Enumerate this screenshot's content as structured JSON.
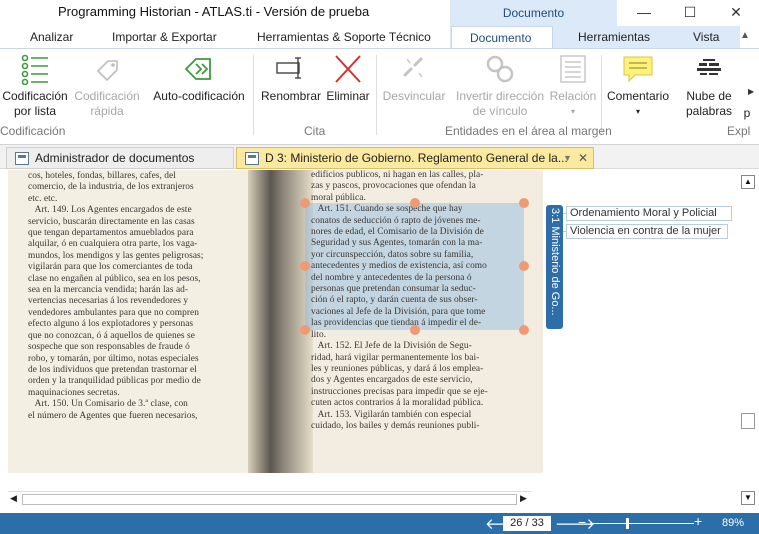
{
  "app": {
    "title": "Programming Historian - ATLAS.ti - Versión de prueba",
    "context_tab": "Documento",
    "window_buttons": [
      "—",
      "☐",
      "✕"
    ]
  },
  "ribbon_tabs": [
    {
      "label": "Analizar"
    },
    {
      "label": "Importar & Exportar"
    },
    {
      "label": "Herramientas & Soporte Técnico"
    },
    {
      "label": "Documento",
      "active": true
    },
    {
      "label": "Herramientas"
    },
    {
      "label": "Vista"
    }
  ],
  "ribbon": {
    "buttons": {
      "codificacion_lista": "Codificación\npor lista",
      "codificacion_rapida": "Codificación\nrápida",
      "auto_codificacion": "Auto-codificación",
      "renombrar": "Renombrar",
      "eliminar": "Eliminar",
      "desvincular": "Desvincular",
      "invertir": "Invertir dirección\nde vínculo",
      "relacion": "Relación",
      "comentario": "Comentario",
      "nube": "Nube de\npalabras",
      "truncated": "p"
    },
    "groups": {
      "codificacion": "Codificación",
      "cita": "Cita",
      "entidades": "Entidades en el área al margen",
      "explorar": "Expl"
    }
  },
  "doc_tabs": [
    {
      "label": "Administrador de documentos",
      "active": false
    },
    {
      "label": "D 3: Ministerio de Gobierno. Reglamento General de la...",
      "active": true
    }
  ],
  "document": {
    "left_page_lines": [
      "cos, hoteles, fondas, billares, cafes, del",
      "comercio, de la industria, de los extranjeros",
      "etc. etc.",
      "   Art. 149. Los Agentes encargados de este",
      "servicio, buscarán directamente en las casas",
      "que tengan departamentos amueblados para",
      "alquilar, ó en cualquiera otra parte, los vaga-",
      "mundos, los mendigos y las gentes peligrosas;",
      "vigilarán para que los comerciantes de toda",
      "clase no engañen al público, sea en los pesos,",
      "sea en la mercancia vendida; harán las ad-",
      "vertencias necesarias á los revendedores y",
      "vendedores ambulantes para que no compren",
      "efecto alguno á los explotadores y personas",
      "que no conozcan, ó á aquellos de quienes se",
      "sospeche que son responsables de fraude ó",
      "robo, y tomarán, por último, notas especiales",
      "de los individuos que pretendan trastornar el",
      "orden y la tranquilidad públicas por medio de",
      "maquinaciones secretas.",
      "   Art. 150. Un Comisario de 3.ª clase, con",
      "el número de Agentes que fueren necesarios,"
    ],
    "right_page_lines": [
      "edificios publicos, ni hagan en las calles, pla-",
      "zas y pascos, provocaciones que ofendan la",
      "moral pública.",
      "   Art. 151. Cuando se sospeche que hay",
      "conatos de seducción ó rapto de jóvenes me-",
      "nores de edad, el Comisario de la División de",
      "Seguridad y sus Agentes, tomarán con la ma-",
      "yor circunspección, datos sobre su familia,",
      "antecedentes y medios de existencia, así como",
      "del nombre y antecedentes de la persona ó",
      "personas que pretendan consumar la seduc-",
      "ción ó el rapto, y darán cuenta de sus obser-",
      "vaciones al Jefe de la División, para que tome",
      "las providencias que tiendan á impedir el de-",
      "lito.",
      "   Art. 152. El Jefe de la División de Segu-",
      "ridad, hará vigilar permanentemente los bai-",
      "les y reuniones públicas, y dará á los emplea-",
      "dos y Agentes encargados de este servicio,",
      "instrucciones precisas para impedir que se eje-",
      "cuten actos contrarios á la moralidad pública.",
      "   Art. 153. Vigilarán también con especial",
      "cuidado, los bailes y demás reuniones publi-"
    ]
  },
  "margin": {
    "quotation": "3:1 Ministerio de Go...",
    "codes": [
      "Ordenamiento Moral y Policial",
      "Violencia en contra de la mujer"
    ]
  },
  "status": {
    "page": "26 / 33",
    "zoom": "89%",
    "zoom_level_percent": 89
  },
  "colors": {
    "accent": "#2c6ea8",
    "context_band": "#dbe9f8",
    "quote_highlight": "#89b9e2",
    "handle": "#ef9a74"
  }
}
